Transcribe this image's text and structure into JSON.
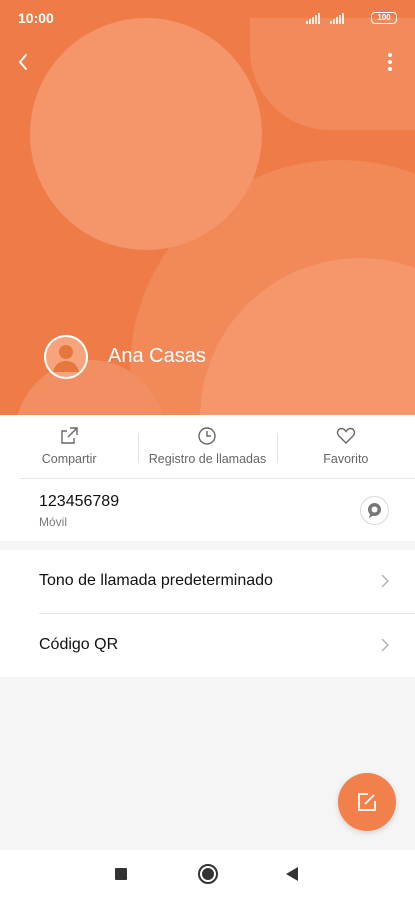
{
  "status_bar": {
    "time": "10:00",
    "battery": "100"
  },
  "contact": {
    "name": "Ana Casas"
  },
  "actions": [
    {
      "label": "Compartir",
      "icon": "share-icon"
    },
    {
      "label": "Registro de llamadas",
      "icon": "clock-icon"
    },
    {
      "label": "Favorito",
      "icon": "heart-icon"
    }
  ],
  "phone": {
    "number": "123456789",
    "type": "Móvil"
  },
  "settings": [
    {
      "label": "Tono de llamada predeterminado"
    },
    {
      "label": "Código QR"
    }
  ],
  "colors": {
    "accent": "#EF7C47",
    "fab": "#F2804B"
  }
}
